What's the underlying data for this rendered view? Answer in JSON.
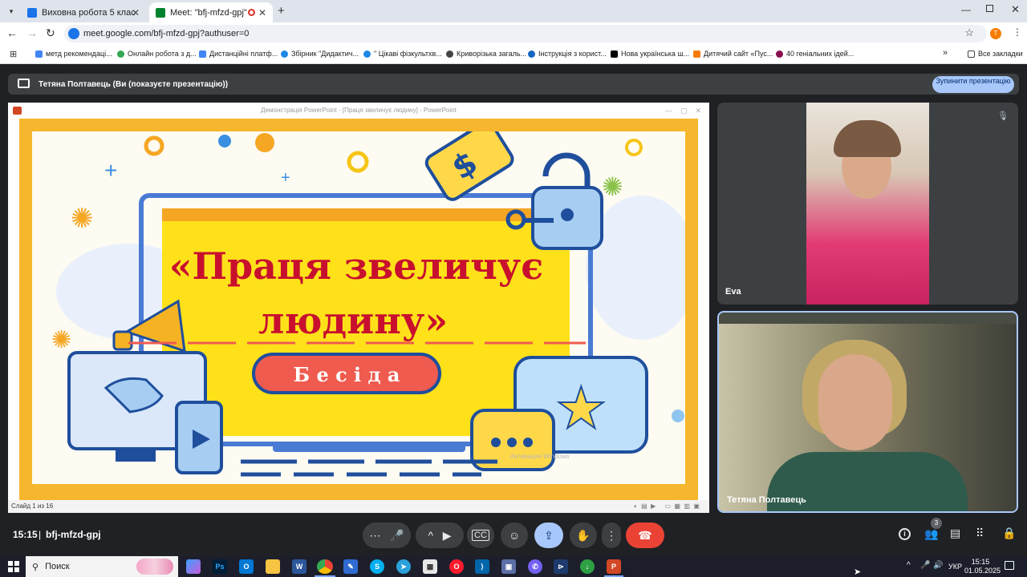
{
  "browser": {
    "tabs": [
      {
        "title": "Виховна робота 5 клас",
        "color": "#1a73e8"
      },
      {
        "title": "Meet: \"bfj-mfzd-gpj\"",
        "color": "#00832d"
      }
    ],
    "new_tab_label": "+",
    "url": "meet.google.com/bfj-mfzd-gpj?authuser=0",
    "profile_initial": "T",
    "bookmarks": [
      {
        "label": "метд рекомендаці...",
        "color": "#4285f4"
      },
      {
        "label": "Онлайн робота з д...",
        "color": "#34a853"
      },
      {
        "label": "Дистанційні платф...",
        "color": "#4285f4"
      },
      {
        "label": "Збірник \"Дидактич...",
        "color": "#1e88e5"
      },
      {
        "label": "\" Цікаві фізкультхв...",
        "color": "#1e88e5"
      },
      {
        "label": "Криворізька загаль...",
        "color": "#444444"
      },
      {
        "label": "Інструкція з корист...",
        "color": "#1565c0"
      },
      {
        "label": "Нова українська ш...",
        "color": "#000000"
      },
      {
        "label": "Дитячий сайт «Пус...",
        "color": "#f57c00"
      },
      {
        "label": "40 геніальних ідей...",
        "color": "#880e4f"
      }
    ],
    "all_bookmarks": "Все закладки"
  },
  "meet": {
    "presenting_text": "Тетяна Полтавець (Ви (показуєте презентацію))",
    "stop_button": "Зупинити презентацію",
    "ppt_title": "Демонстрація PowerPoint - [Праця звеличує людину] - PowerPoint",
    "slide_title_line1": "«Праця звеличує",
    "slide_title_line2": "людину»",
    "slide_button": "Б е с і д а",
    "watermark": "Активация Windows",
    "slide_counter": "Слайд 1 из 16",
    "participants": [
      {
        "name": "Eva"
      },
      {
        "name": "Тетяна Полтавець"
      }
    ],
    "time": "15:15",
    "meeting_code": "bfj-mfzd-gpj",
    "people_count": "3"
  },
  "taskbar": {
    "search_placeholder": "Поиск",
    "lang": "УКР",
    "clock_time": "15:15",
    "clock_date": "01.05.2025"
  },
  "colors": {
    "meet_bg": "#202124",
    "accent_blue": "#a8c7fa",
    "end_call_red": "#ea4335",
    "slide_border": "#f6b62d",
    "slide_title_red": "#c8102e"
  }
}
